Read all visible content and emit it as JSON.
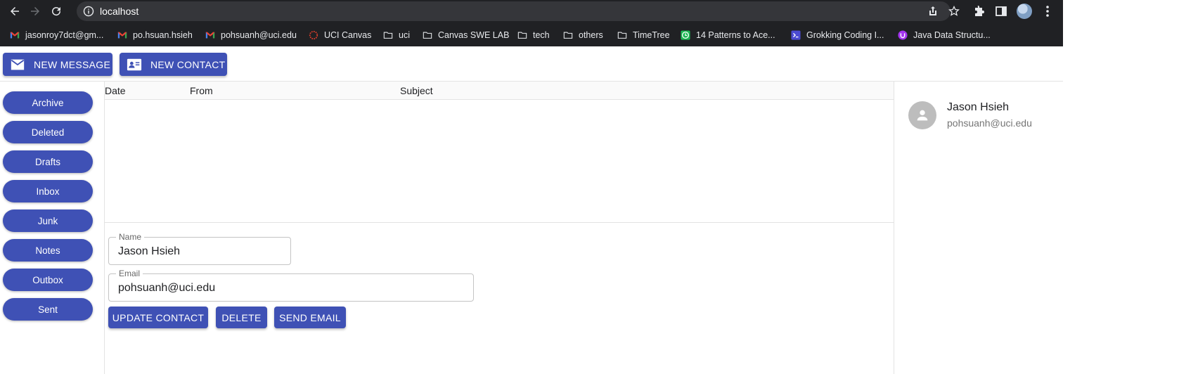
{
  "browser": {
    "url": "localhost",
    "bookmarks": [
      {
        "label": "jasonroy7dct@gm...",
        "icon": "gmail-icon"
      },
      {
        "label": "po.hsuan.hsieh",
        "icon": "gmail-icon"
      },
      {
        "label": "pohsuanh@uci.edu",
        "icon": "gmail-icon"
      },
      {
        "label": "UCI Canvas",
        "icon": "canvas-icon"
      },
      {
        "label": "uci",
        "icon": "folder-icon"
      },
      {
        "label": "Canvas SWE LAB",
        "icon": "folder-icon"
      },
      {
        "label": "tech",
        "icon": "folder-icon"
      },
      {
        "label": "others",
        "icon": "folder-icon"
      },
      {
        "label": "TimeTree",
        "icon": "folder-icon"
      },
      {
        "label": "14 Patterns to Ace...",
        "icon": "clock-icon"
      },
      {
        "label": "Grokking Coding I...",
        "icon": "terminal-icon"
      },
      {
        "label": "Java Data Structu...",
        "icon": "udemy-icon"
      }
    ]
  },
  "toolbar": {
    "new_message_label": "NEW MESSAGE",
    "new_contact_label": "NEW CONTACT"
  },
  "sidebar": {
    "folders": [
      "Archive",
      "Deleted",
      "Drafts",
      "Inbox",
      "Junk",
      "Notes",
      "Outbox",
      "Sent"
    ]
  },
  "message_list": {
    "columns": [
      "Date",
      "From",
      "Subject"
    ],
    "rows": []
  },
  "contact_form": {
    "name_label": "Name",
    "name_value": "Jason Hsieh",
    "email_label": "Email",
    "email_value": "pohsuanh@uci.edu",
    "update_label": "UPDATE CONTACT",
    "delete_label": "DELETE",
    "send_label": "SEND EMAIL"
  },
  "contacts": [
    {
      "name": "Jason Hsieh",
      "email": "pohsuanh@uci.edu"
    }
  ],
  "colors": {
    "primary": "#3f51b5",
    "chrome_dark": "#202124",
    "omnibox": "#35363a",
    "avatar_grey": "#bdbdbd"
  }
}
